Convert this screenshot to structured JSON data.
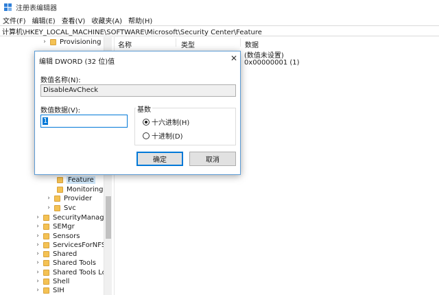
{
  "window": {
    "title": "注册表编辑器"
  },
  "menu": [
    "文件(F)",
    "编辑(E)",
    "查看(V)",
    "收藏夹(A)",
    "帮助(H)"
  ],
  "address": "计算机\\HKEY_LOCAL_MACHINE\\SOFTWARE\\Microsoft\\Security Center\\Feature",
  "tree": [
    {
      "label": "Provisioning",
      "chevron": true,
      "indent": 0
    },
    {
      "label": "Feature",
      "chevron": false,
      "indent": 1,
      "selected": true
    },
    {
      "label": "Monitoring",
      "chevron": false,
      "indent": 1
    },
    {
      "label": "Provider",
      "chevron": true,
      "indent": 1
    },
    {
      "label": "Svc",
      "chevron": true,
      "indent": 1
    },
    {
      "label": "SecurityManage",
      "chevron": true,
      "indent": 0
    },
    {
      "label": "SEMgr",
      "chevron": true,
      "indent": 0
    },
    {
      "label": "Sensors",
      "chevron": true,
      "indent": 0
    },
    {
      "label": "ServicesForNFS",
      "chevron": true,
      "indent": 0
    },
    {
      "label": "Shared",
      "chevron": true,
      "indent": 0
    },
    {
      "label": "Shared Tools",
      "chevron": true,
      "indent": 0
    },
    {
      "label": "Shared Tools Lo",
      "chevron": true,
      "indent": 0
    },
    {
      "label": "Shell",
      "chevron": true,
      "indent": 0
    },
    {
      "label": "SIH",
      "chevron": true,
      "indent": 0
    }
  ],
  "list": {
    "headers": {
      "name": "名称",
      "type": "类型",
      "data": "数据"
    },
    "rows": [
      {
        "data": "(数值未设置)"
      },
      {
        "data": "0x00000001 (1)"
      }
    ]
  },
  "dialog": {
    "title": "编辑 DWORD (32 位)值",
    "close_glyph": "✕",
    "value_name_label": "数值名称(N):",
    "value_name": "DisableAvCheck",
    "value_data_label": "数值数据(V):",
    "value_data": "1",
    "base_label": "基数",
    "hex_label": "十六进制(H)",
    "dec_label": "十进制(D)",
    "hex_selected": true,
    "ok_label": "确定",
    "cancel_label": "取消"
  },
  "colors": {
    "accent": "#0078d7",
    "folder": "#f4c254",
    "selection": "#cce4f7"
  },
  "icons": {
    "app": "registry-editor-icon",
    "folder": "folder-icon",
    "chevron": "chevron-right-icon",
    "close": "close-icon"
  }
}
